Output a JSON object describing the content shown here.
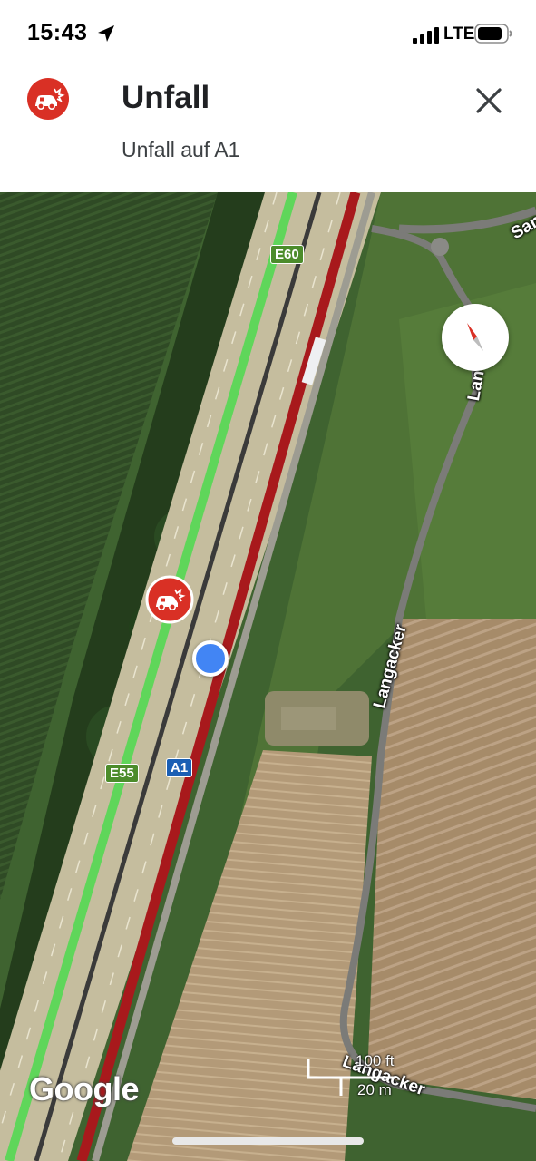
{
  "status_bar": {
    "time": "15:43",
    "network": "LTE",
    "icons": [
      "location-arrow-icon",
      "signal-bars-icon",
      "battery-icon"
    ]
  },
  "header": {
    "icon": "car-crash-icon",
    "title": "Unfall",
    "subtitle": "Unfall auf A1",
    "close_icon": "close-icon"
  },
  "map": {
    "road_shields": {
      "e60": "E60",
      "e55": "E55",
      "a1": "A1"
    },
    "road_labels": {
      "langacker_mid": "Langacker",
      "langacker_top": "Lan",
      "langacker_bottom": "Langacker",
      "sand_partial": "San"
    },
    "scale": {
      "imperial": "100 ft",
      "metric": "20 m"
    },
    "attribution": "Google",
    "colors": {
      "traffic_free": "#5fd65a",
      "traffic_jam": "#a8191c",
      "incident_red": "#d93025",
      "location_blue": "#4285f4"
    },
    "incident_marker": "car-crash-icon",
    "compass_icon": "compass-icon"
  }
}
